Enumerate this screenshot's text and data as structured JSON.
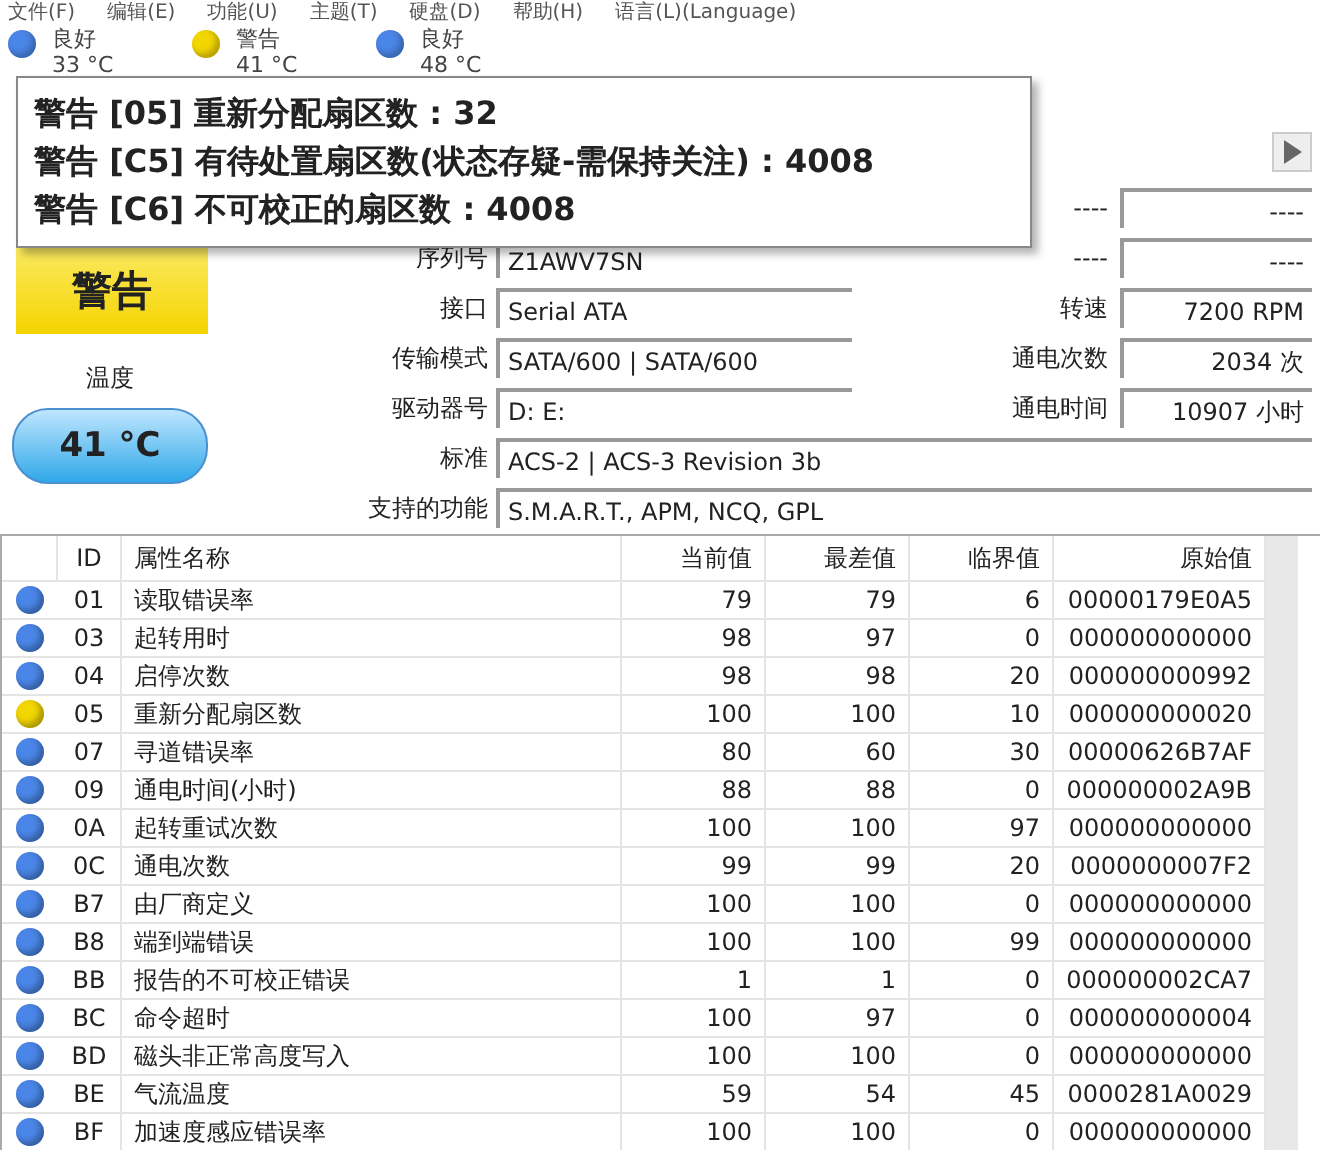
{
  "menu": [
    "文件(F)",
    "编辑(E)",
    "功能(U)",
    "主题(T)",
    "硬盘(D)",
    "帮助(H)",
    "语言(L)(Language)"
  ],
  "drives": [
    {
      "status": "良好",
      "temp": "33 °C",
      "color": "#4a86e8"
    },
    {
      "status": "警告",
      "temp": "41 °C",
      "color": "#f2d600"
    },
    {
      "status": "良好",
      "temp": "48 °C",
      "color": "#4a86e8"
    }
  ],
  "tooltip": {
    "lines": [
      "警告 [05] 重新分配扇区数 : 32",
      "警告 [C5] 有待处置扇区数(状态存疑-需保持关注) : 4008",
      "警告 [C6] 不可校正的扇区数 : 4008"
    ]
  },
  "health": {
    "text": "警告"
  },
  "temperature": {
    "label": "温度",
    "value": "41 °C"
  },
  "info": {
    "rows": [
      {
        "right_label": "----",
        "right_value": "----"
      },
      {
        "label": "序列号",
        "value": "Z1AWV7SN",
        "right_label": "----",
        "right_value": "----"
      },
      {
        "label": "接口",
        "value": "Serial ATA",
        "right_label": "转速",
        "right_value": "7200 RPM"
      },
      {
        "label": "传输模式",
        "value": "SATA/600 | SATA/600",
        "right_label": "通电次数",
        "right_value": "2034 次"
      },
      {
        "label": "驱动器号",
        "value": "D: E:",
        "right_label": "通电时间",
        "right_value": "10907 小时"
      },
      {
        "label": "标准",
        "value": "ACS-2 | ACS-3 Revision 3b"
      },
      {
        "label": "支持的功能",
        "value": "S.M.A.R.T., APM, NCQ, GPL"
      }
    ]
  },
  "smart": {
    "columns": [
      "ID",
      "属性名称",
      "当前值",
      "最差值",
      "临界值",
      "原始值"
    ],
    "rows": [
      {
        "color": "#4a86e8",
        "id": "01",
        "name": "读取错误率",
        "current": "79",
        "worst": "79",
        "threshold": "6",
        "raw": "00000179E0A5"
      },
      {
        "color": "#4a86e8",
        "id": "03",
        "name": "起转用时",
        "current": "98",
        "worst": "97",
        "threshold": "0",
        "raw": "000000000000"
      },
      {
        "color": "#4a86e8",
        "id": "04",
        "name": "启停次数",
        "current": "98",
        "worst": "98",
        "threshold": "20",
        "raw": "000000000992"
      },
      {
        "color": "#f2d600",
        "id": "05",
        "name": "重新分配扇区数",
        "current": "100",
        "worst": "100",
        "threshold": "10",
        "raw": "000000000020"
      },
      {
        "color": "#4a86e8",
        "id": "07",
        "name": "寻道错误率",
        "current": "80",
        "worst": "60",
        "threshold": "30",
        "raw": "00000626B7AF"
      },
      {
        "color": "#4a86e8",
        "id": "09",
        "name": "通电时间(小时)",
        "current": "88",
        "worst": "88",
        "threshold": "0",
        "raw": "000000002A9B"
      },
      {
        "color": "#4a86e8",
        "id": "0A",
        "name": "起转重试次数",
        "current": "100",
        "worst": "100",
        "threshold": "97",
        "raw": "000000000000"
      },
      {
        "color": "#4a86e8",
        "id": "0C",
        "name": "通电次数",
        "current": "99",
        "worst": "99",
        "threshold": "20",
        "raw": "0000000007F2"
      },
      {
        "color": "#4a86e8",
        "id": "B7",
        "name": "由厂商定义",
        "current": "100",
        "worst": "100",
        "threshold": "0",
        "raw": "000000000000"
      },
      {
        "color": "#4a86e8",
        "id": "B8",
        "name": "端到端错误",
        "current": "100",
        "worst": "100",
        "threshold": "99",
        "raw": "000000000000"
      },
      {
        "color": "#4a86e8",
        "id": "BB",
        "name": "报告的不可校正错误",
        "current": "1",
        "worst": "1",
        "threshold": "0",
        "raw": "000000002CA7"
      },
      {
        "color": "#4a86e8",
        "id": "BC",
        "name": "命令超时",
        "current": "100",
        "worst": "97",
        "threshold": "0",
        "raw": "000000000004"
      },
      {
        "color": "#4a86e8",
        "id": "BD",
        "name": "磁头非正常高度写入",
        "current": "100",
        "worst": "100",
        "threshold": "0",
        "raw": "000000000000"
      },
      {
        "color": "#4a86e8",
        "id": "BE",
        "name": "气流温度",
        "current": "59",
        "worst": "54",
        "threshold": "45",
        "raw": "0000281A0029"
      },
      {
        "color": "#4a86e8",
        "id": "BF",
        "name": "加速度感应错误率",
        "current": "100",
        "worst": "100",
        "threshold": "0",
        "raw": "000000000000"
      }
    ]
  }
}
